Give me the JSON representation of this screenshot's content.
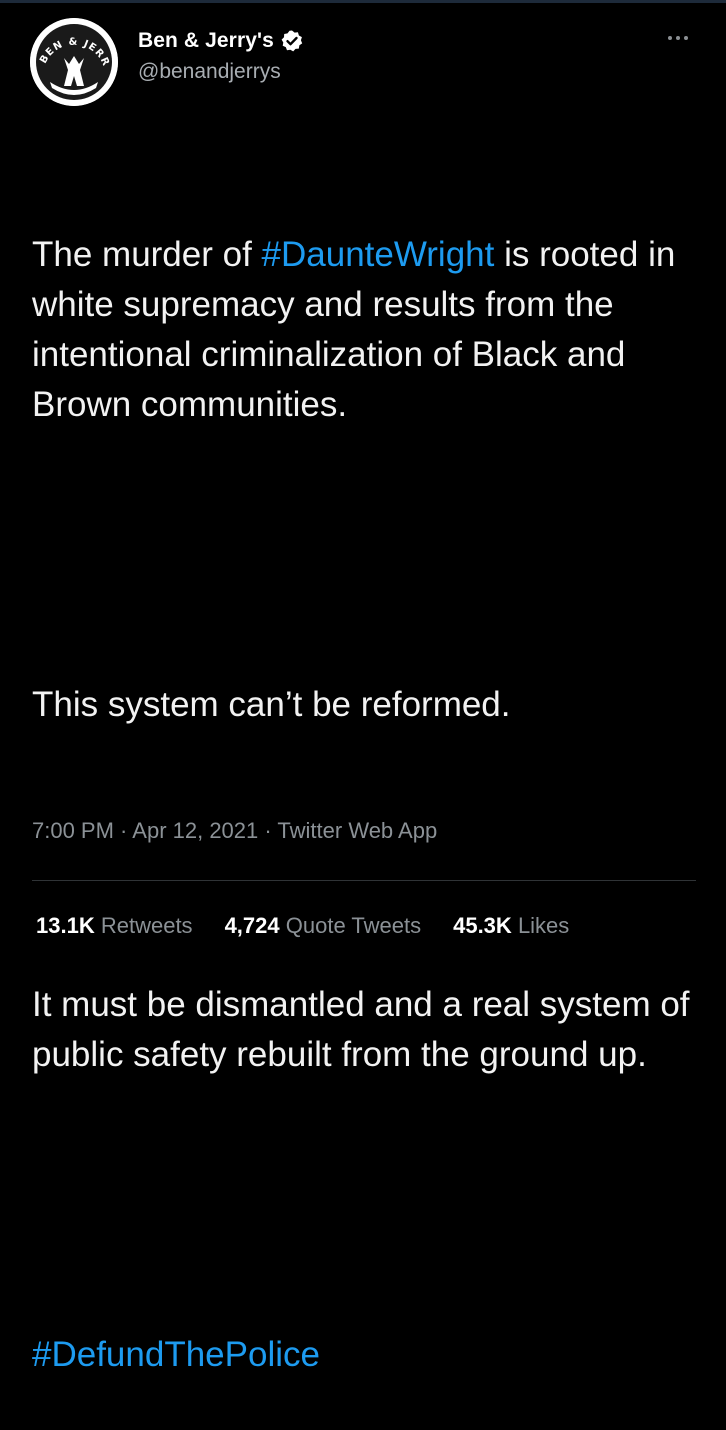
{
  "account": {
    "display_name": "Ben & Jerry's",
    "handle": "@benandjerrys",
    "verified": true,
    "avatar_icon": "ben-and-jerrys-logo-icon",
    "avatar_text": "BEN & JERRY'S"
  },
  "tweet": {
    "para1_before": "The murder of ",
    "hashtag1": "#DaunteWright",
    "para1_after": " is rooted in white supremacy and results from the intentional criminalization of Black and Brown communities.",
    "para2": "This system can’t be reformed.",
    "para3": "It must be dismantled and a real system of public safety rebuilt from the ground up.",
    "hashtag2": "#DefundThePolice"
  },
  "meta": {
    "time": "7:00 PM",
    "separator": " · ",
    "date": "Apr 12, 2021",
    "source": "Twitter Web App"
  },
  "stats": {
    "retweets_count": "13.1K",
    "retweets_label": "Retweets",
    "quotes_count": "4,724",
    "quotes_label": "Quote Tweets",
    "likes_count": "45.3K",
    "likes_label": "Likes"
  },
  "colors": {
    "background": "#000000",
    "link": "#1d9bf0",
    "secondary_text": "#8b9196"
  }
}
